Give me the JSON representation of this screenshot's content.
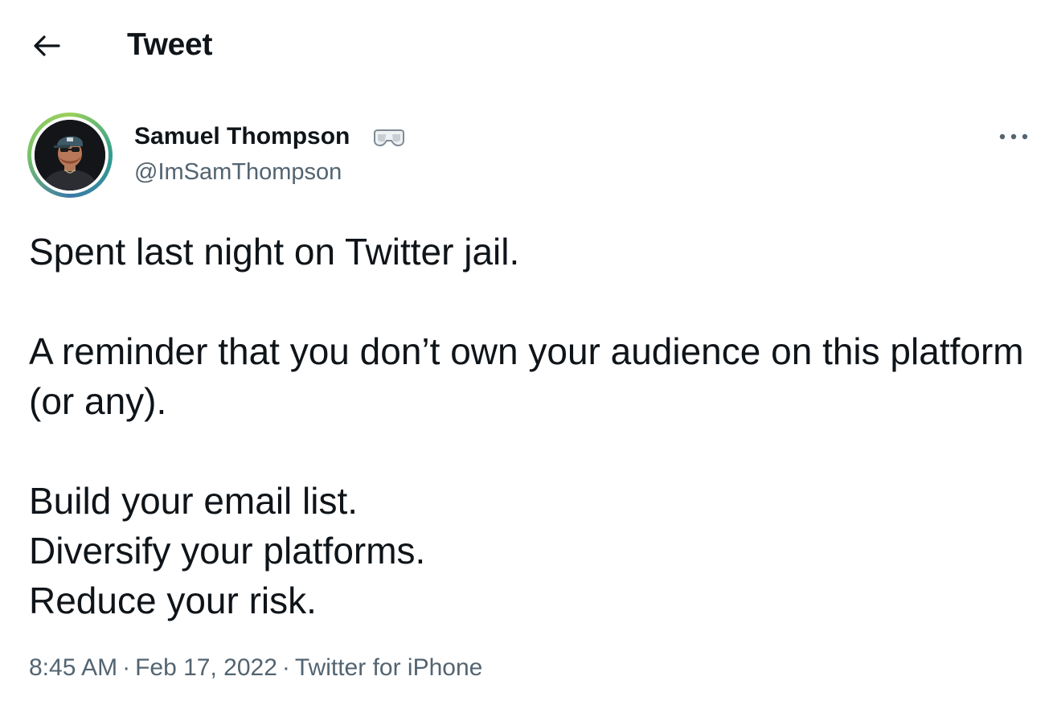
{
  "header": {
    "back_icon": "arrow-left-icon",
    "title": "Tweet"
  },
  "author": {
    "display_name": "Samuel Thompson",
    "badge_icon": "vr-goggles-icon",
    "handle": "@ImSamThompson",
    "avatar_ring_colors": [
      "#9ad05a",
      "#2f9e8f",
      "#3c78a8"
    ]
  },
  "more_icon": "more-horizontal-icon",
  "tweet": {
    "line1": "Spent last night on Twitter jail.",
    "paragraph2": "A reminder that you don’t own your audience on this platform (or any).",
    "line3": "Build your email list.",
    "line4": "Diversify your platforms.",
    "line5": "Reduce your risk."
  },
  "meta": {
    "time": "8:45 AM",
    "separator": "·",
    "date": "Feb 17, 2022",
    "source": "Twitter for iPhone"
  },
  "colors": {
    "text_primary": "#0f1419",
    "text_secondary": "#536471",
    "background": "#ffffff"
  }
}
